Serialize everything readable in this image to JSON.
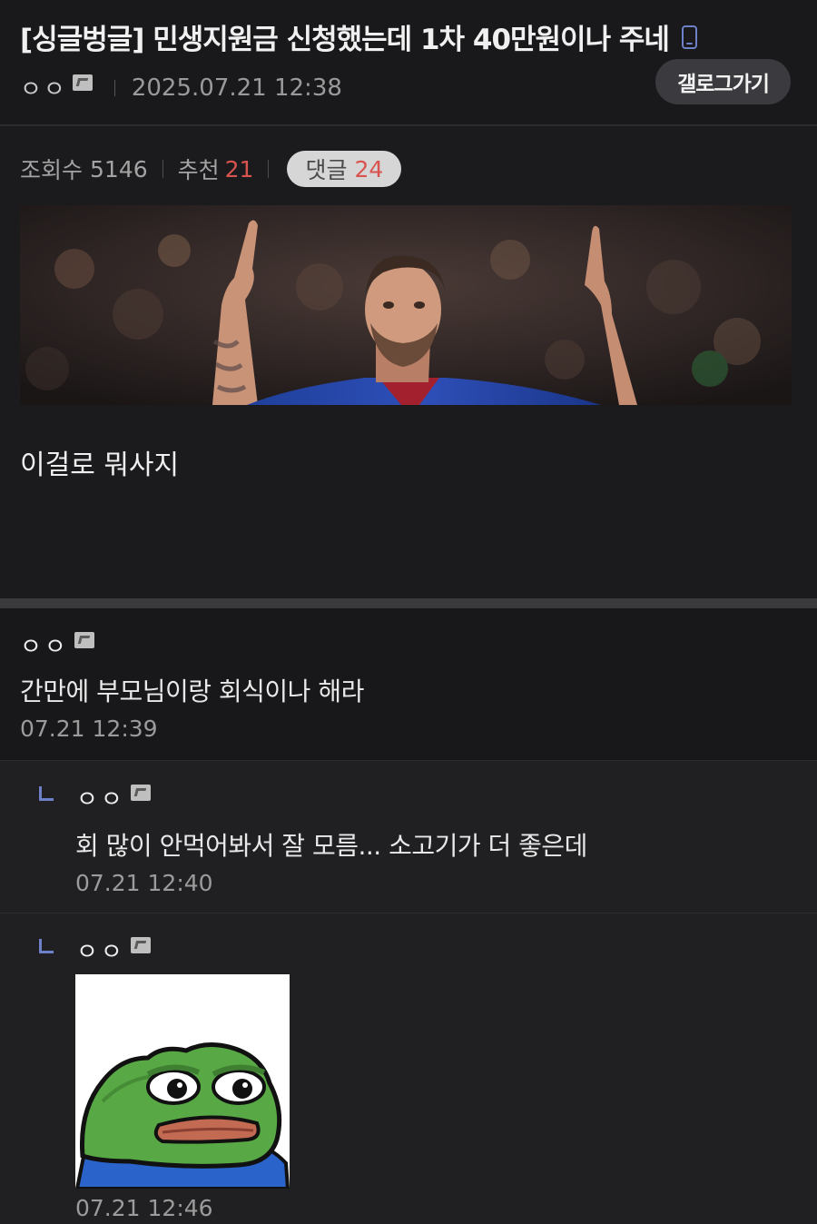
{
  "post": {
    "title": "[싱글벙글] 민생지원금 신청했는데 1차 40만원이나 주네",
    "author": "ㅇㅇ",
    "datetime": "2025.07.21 12:38",
    "gallery_button": "갤로그가기",
    "views_label": "조회수",
    "views": "5146",
    "recommend_label": "추천",
    "recommend": "21",
    "comments_label": "댓글",
    "comments": "24",
    "body": "이걸로 뭐사지"
  },
  "comments": [
    {
      "author": "ㅇㅇ",
      "text": "간만에 부모님이랑 회식이나 해라",
      "date": "07.21 12:39"
    },
    {
      "author": "ㅇㅇ",
      "text": "회 많이 안먹어봐서 잘 모름... 소고기가 더 좋은데",
      "date": "07.21 12:40"
    },
    {
      "author": "ㅇㅇ",
      "text": "",
      "date": "07.21 12:46"
    }
  ],
  "colors": {
    "accent": "#6d80c8",
    "red": "#d9534f",
    "background": "#1b1b1d"
  },
  "icons": {
    "device": "mobile-icon",
    "user_badge": "fixed-nick-icon",
    "reply": "reply-arrow-icon"
  }
}
